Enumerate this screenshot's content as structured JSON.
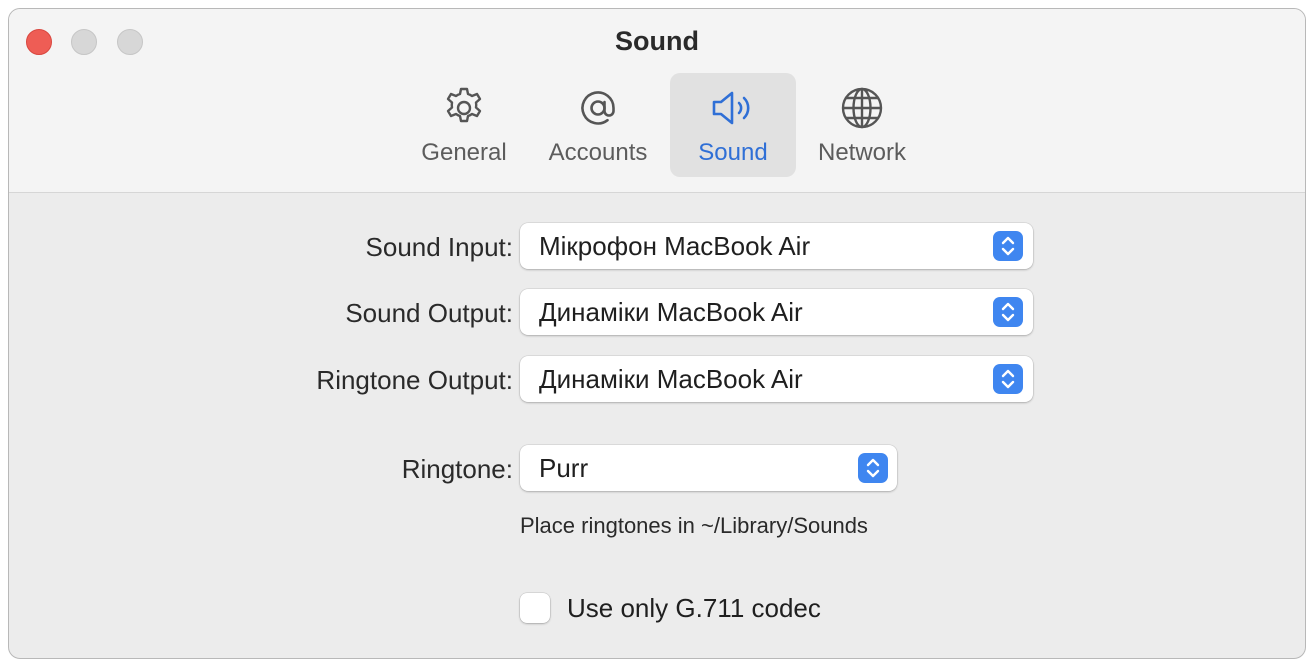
{
  "window": {
    "title": "Sound"
  },
  "tabs": [
    {
      "label": "General",
      "icon": "gear-icon"
    },
    {
      "label": "Accounts",
      "icon": "at-sign-icon"
    },
    {
      "label": "Sound",
      "icon": "speaker-icon",
      "selected": true
    },
    {
      "label": "Network",
      "icon": "globe-icon"
    }
  ],
  "settings": {
    "sound_input": {
      "label": "Sound Input:",
      "value": "Мікрофон MacBook Air"
    },
    "sound_output": {
      "label": "Sound Output:",
      "value": "Динаміки MacBook Air"
    },
    "ringtone_output": {
      "label": "Ringtone Output:",
      "value": "Динаміки MacBook Air"
    },
    "ringtone": {
      "label": "Ringtone:",
      "value": "Purr"
    },
    "ringtone_hint": "Place ringtones in ~/Library/Sounds",
    "g711": {
      "label": "Use only G.711 codec",
      "checked": false
    }
  },
  "colors": {
    "accent": "#3f86f0",
    "selected_tab_text": "#2f6fd6",
    "close": "#ee5d55"
  }
}
